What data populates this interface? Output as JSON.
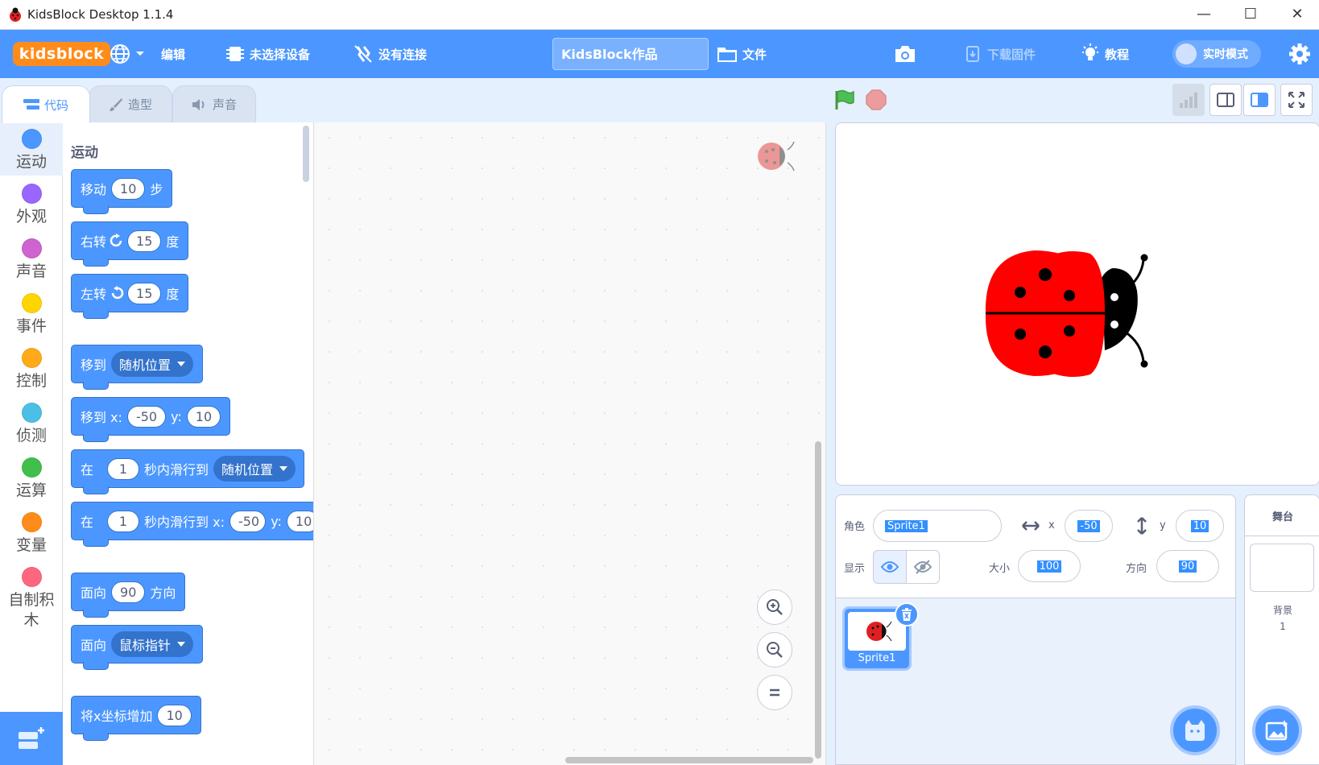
{
  "window": {
    "title": "KidsBlock Desktop 1.1.4",
    "minimize": "—",
    "maximize": "☐",
    "close": "✕"
  },
  "menu": {
    "logo": "kidsblock",
    "edit": "编辑",
    "device": "未选择设备",
    "connection": "没有连接",
    "project_title": "KidsBlock作品",
    "file": "文件",
    "download_firmware": "下载固件",
    "tutorial": "教程",
    "realtime_mode": "实时模式"
  },
  "tabs": {
    "code": "代码",
    "costumes": "造型",
    "sounds": "声音"
  },
  "categories": [
    {
      "label": "运动",
      "color": "#4c97ff"
    },
    {
      "label": "外观",
      "color": "#9966ff"
    },
    {
      "label": "声音",
      "color": "#cf63cf"
    },
    {
      "label": "事件",
      "color": "#ffd500"
    },
    {
      "label": "控制",
      "color": "#ffab19"
    },
    {
      "label": "侦测",
      "color": "#4cbfe6"
    },
    {
      "label": "运算",
      "color": "#40bf4a"
    },
    {
      "label": "变量",
      "color": "#ff8c1a"
    },
    {
      "label": "自制积木",
      "color": "#ff6680"
    }
  ],
  "flyout": {
    "heading": "运动",
    "move": {
      "a": "移动",
      "n": "10",
      "b": "步"
    },
    "turn_right": {
      "a": "右转",
      "n": "15",
      "b": "度"
    },
    "turn_left": {
      "a": "左转",
      "n": "15",
      "b": "度"
    },
    "goto": {
      "a": "移到",
      "opt": "随机位置"
    },
    "goto_xy": {
      "a": "移到 x:",
      "x": "-50",
      "yl": "y:",
      "y": "10"
    },
    "glide": {
      "a": "在",
      "n": "1",
      "b": "秒内滑行到",
      "opt": "随机位置"
    },
    "glide_xy": {
      "a": "在",
      "n": "1",
      "b": "秒内滑行到 x:",
      "x": "-50",
      "yl": "y:",
      "y": "10"
    },
    "point_dir": {
      "a": "面向",
      "n": "90",
      "b": "方向"
    },
    "point_to": {
      "a": "面向",
      "opt": "鼠标指针"
    },
    "change_x": {
      "a": "将x坐标增加",
      "n": "10"
    }
  },
  "sprite_info": {
    "sprite_label": "角色",
    "sprite_name": "Sprite1",
    "x_label": "x",
    "x": "-50",
    "y_label": "y",
    "y": "10",
    "show_label": "显示",
    "size_label": "大小",
    "size": "100",
    "direction_label": "方向",
    "direction": "90"
  },
  "sprites": [
    {
      "name": "Sprite1"
    }
  ],
  "stage_panel": {
    "title": "舞台",
    "backdrops_label": "背景",
    "backdrops_count": "1"
  },
  "icons": [
    "globe-icon",
    "chevron-down-icon",
    "chip-icon",
    "unplug-icon",
    "folder-icon",
    "camera-icon",
    "firmware-icon",
    "lightbulb-icon",
    "gear-icon",
    "green-flag-icon",
    "stop-icon",
    "zoom-in-icon",
    "zoom-out-icon",
    "zoom-reset-icon",
    "trash-icon",
    "eye-icon",
    "eye-off-icon"
  ],
  "colors": {
    "brand": "#4c97ff",
    "logo": "#ff8c1a",
    "motion": "#4c97ff"
  }
}
